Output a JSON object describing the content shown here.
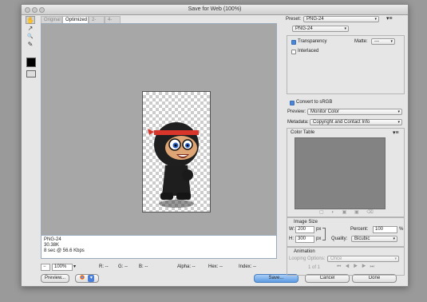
{
  "window": {
    "title": "Save for Web (100%)"
  },
  "tools": [
    {
      "name": "hand-tool-icon",
      "glyph": "✋"
    },
    {
      "name": "slice-select-tool-icon",
      "glyph": "↗"
    },
    {
      "name": "zoom-tool-icon",
      "glyph": "🔍"
    },
    {
      "name": "eyedropper-tool-icon",
      "glyph": "✎"
    }
  ],
  "tabs": [
    "Original",
    "Optimized",
    "2-Up",
    "4-Up"
  ],
  "info": {
    "format": "PNG-24",
    "size": "30.38K",
    "speed": "8 sec @ 56.6 Kbps"
  },
  "status": {
    "zoom": "100%",
    "r": "R: --",
    "g": "G: --",
    "b": "B: --",
    "alpha": "Alpha: --",
    "hex": "Hex: --",
    "index": "Index: --"
  },
  "buttons": {
    "preview": "Preview...",
    "save": "Save...",
    "cancel": "Cancel",
    "done": "Done"
  },
  "preset": {
    "label": "Preset:",
    "value": "PNG-24"
  },
  "format": {
    "value": "PNG-24"
  },
  "transparency": {
    "label": "Transparency",
    "checked": true
  },
  "matte": {
    "label": "Matte:",
    "value": "---"
  },
  "interlaced": {
    "label": "Interlaced",
    "checked": false
  },
  "convert_srgb": {
    "label": "Convert to sRGB",
    "checked": true
  },
  "preview_opt": {
    "label": "Preview:",
    "value": "Monitor Color"
  },
  "metadata": {
    "label": "Metadata:",
    "value": "Copyright and Contact Info"
  },
  "color_table": {
    "label": "Color Table"
  },
  "image_size": {
    "label": "Image Size",
    "w_label": "W:",
    "w": "200",
    "h_label": "H:",
    "h": "300",
    "unit": "px",
    "percent_label": "Percent:",
    "percent": "100",
    "percent_unit": "%",
    "quality_label": "Quality:",
    "quality": "Bicubic"
  },
  "animation": {
    "label": "Animation",
    "looping_label": "Looping Options:",
    "looping": "Once",
    "frame": "1 of 1"
  },
  "colors": {
    "accent": "#4a86d9",
    "canvas": "#a7a7a7",
    "save_blue": "#5d9be3"
  }
}
